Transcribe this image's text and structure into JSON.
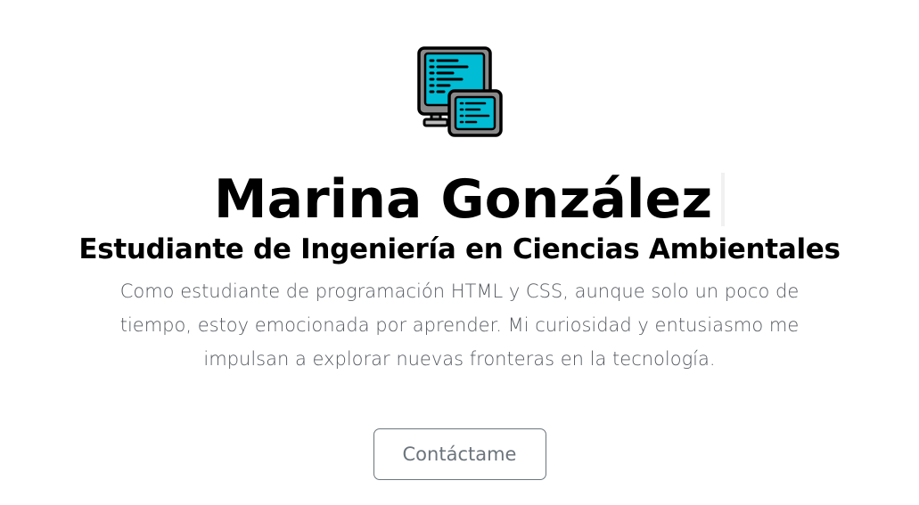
{
  "hero": {
    "icon": "code-monitor-icon",
    "name": "Marina González",
    "subtitle": "Estudiante de Ingeniería en Ciencias Ambientales",
    "description": "Como estudiante de programación HTML y CSS, aunque solo un poco de tiempo, estoy emocionada por aprender. Mi curiosidad y entusiasmo me impulsan a explorar nuevas fronteras en la tecnología.",
    "contact_label": "Contáctame"
  },
  "colors": {
    "screen": "#00bcd4",
    "frame": "#7a7a7a",
    "text_muted": "#555a60",
    "button_border": "#6c757d"
  }
}
